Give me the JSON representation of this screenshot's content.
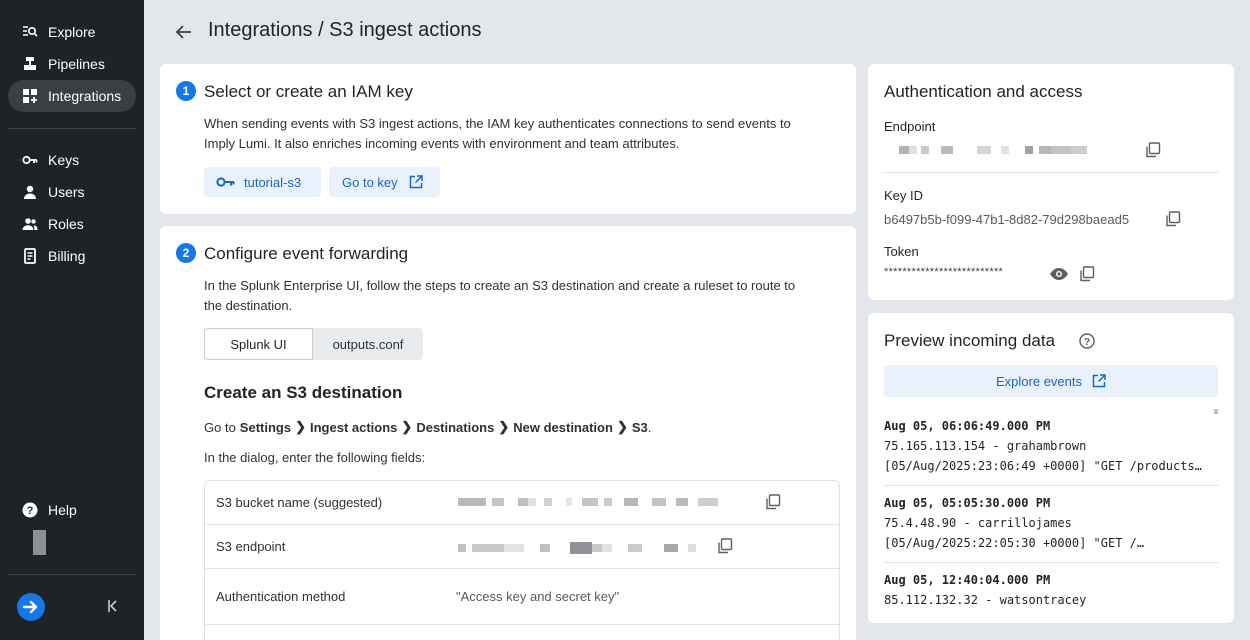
{
  "sidebar": {
    "items": [
      {
        "label": "Explore",
        "icon": "explore-icon"
      },
      {
        "label": "Pipelines",
        "icon": "pipelines-icon"
      },
      {
        "label": "Integrations",
        "icon": "integrations-icon",
        "active": true
      },
      {
        "label": "Keys",
        "icon": "key-icon"
      },
      {
        "label": "Users",
        "icon": "user-icon"
      },
      {
        "label": "Roles",
        "icon": "roles-icon"
      },
      {
        "label": "Billing",
        "icon": "billing-icon"
      }
    ],
    "help_label": "Help"
  },
  "header": {
    "title": "Integrations / S3 ingest actions"
  },
  "step1": {
    "number": "1",
    "title": "Select or create an IAM key",
    "description_line1": "When sending events with S3 ingest actions, the IAM key authenticates connections to send events to",
    "description_line2": "Imply Lumi. It also enriches incoming events with environment and team attributes.",
    "key_chip": "tutorial-s3",
    "go_to_key": "Go to key"
  },
  "step2": {
    "number": "2",
    "title": "Configure event forwarding",
    "description_line1": "In the Splunk Enterprise UI, follow the steps to create an S3 destination and create a ruleset to route to",
    "description_line2": "the destination.",
    "tabs": [
      "Splunk UI",
      "outputs.conf"
    ],
    "section_title": "Create an S3 destination",
    "goto_prefix": "Go to",
    "path": [
      "Settings",
      "Ingest actions",
      "Destinations",
      "New destination",
      "S3"
    ],
    "dialog_text": "In the dialog, enter the following fields:",
    "fields": [
      {
        "label": "S3 bucket name (suggested)",
        "value": ""
      },
      {
        "label": "S3 endpoint",
        "value": ""
      },
      {
        "label": "Authentication method",
        "value": "\"Access key and secret key\""
      }
    ]
  },
  "auth": {
    "title": "Authentication and access",
    "endpoint_label": "Endpoint",
    "key_id_label": "Key ID",
    "key_id_value": "b6497b5b-f099-47b1-8d82-79d298baead5",
    "token_label": "Token",
    "token_value": "**************************"
  },
  "preview": {
    "title": "Preview incoming data",
    "explore_button": "Explore events",
    "events": [
      {
        "timestamp": "Aug 05, 06:06:49.000 PM",
        "line1": "75.165.113.154 - grahambrown",
        "line2": "[05/Aug/2025:23:06:49 +0000] \"GET /products…"
      },
      {
        "timestamp": "Aug 05, 05:05:30.000 PM",
        "line1": "75.4.48.90 - carrillojames",
        "line2": "[05/Aug/2025:22:05:30 +0000] \"GET /…"
      },
      {
        "timestamp": "Aug 05, 12:40:04.000 PM",
        "line1": "85.112.132.32 - watsontracey",
        "line2": ""
      }
    ]
  },
  "colors": {
    "accent": "#1677e8",
    "sidebar_bg": "#1f2327",
    "page_bg": "#e3e7ec"
  }
}
